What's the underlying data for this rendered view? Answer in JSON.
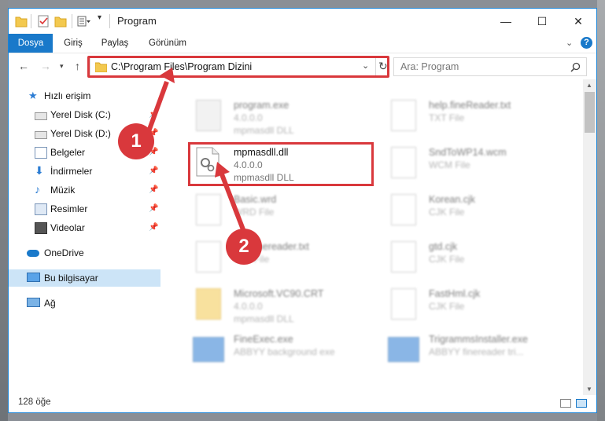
{
  "window": {
    "title": "Program",
    "status_count": "128 öğe"
  },
  "ribbon": {
    "tabs": [
      "Dosya",
      "Giriş",
      "Paylaş",
      "Görünüm"
    ]
  },
  "address": {
    "path": "C:\\Program Files\\Program Dizini",
    "search_placeholder": "Ara: Program"
  },
  "sidebar": {
    "items": [
      {
        "label": "Hızlı erişim"
      },
      {
        "label": "Yerel Disk (C:)"
      },
      {
        "label": "Yerel Disk (D:)"
      },
      {
        "label": "Belgeler"
      },
      {
        "label": "İndirmeler"
      },
      {
        "label": "Müzik"
      },
      {
        "label": "Resimler"
      },
      {
        "label": "Videolar"
      },
      {
        "label": "OneDrive"
      },
      {
        "label": "Bu bilgisayar"
      },
      {
        "label": "Ağ"
      }
    ]
  },
  "files": {
    "left": [
      {
        "name": "program.exe",
        "line2": "4.0.0.0",
        "line3": "mpmasdll DLL"
      },
      {
        "name": "mpmasdll.dll",
        "line2": "4.0.0.0",
        "line3": "mpmasdll DLL"
      },
      {
        "name": "Basic.wrd",
        "line2": "WRD File",
        "line3": ""
      },
      {
        "name": "helpfinereader.txt",
        "line2": "TXT File",
        "line3": ""
      },
      {
        "name": "Microsoft.VC90.CRT",
        "line2": "4.0.0.0",
        "line3": "mpmasdll DLL"
      },
      {
        "name": "FineExec.exe",
        "line2": "ABBYY background exe",
        "line3": ""
      }
    ],
    "right": [
      {
        "name": "help.fineReader.txt",
        "line2": "TXT File"
      },
      {
        "name": "SndToWP14.wcm",
        "line2": "WCM File"
      },
      {
        "name": "Korean.cjk",
        "line2": "CJK File"
      },
      {
        "name": "gtd.cjk",
        "line2": "CJK File"
      },
      {
        "name": "FastHml.cjk",
        "line2": "CJK File"
      },
      {
        "name": "TrigrammsInstaller.exe",
        "line2": "ABBYY finereader tri..."
      }
    ]
  },
  "callouts": [
    "1",
    "2"
  ],
  "colors": {
    "accent": "#1979ca",
    "highlight": "#d9383c",
    "selected_nav": "#cce4f7"
  }
}
